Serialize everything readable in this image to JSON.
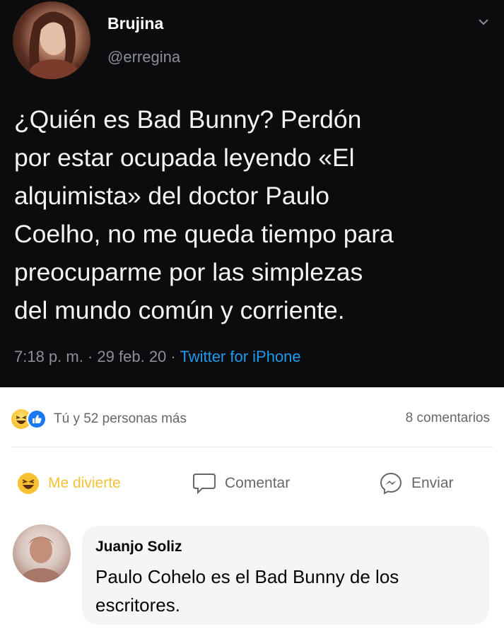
{
  "tweet": {
    "display_name": "Brujina",
    "handle": "@erregina",
    "text_lines": [
      "¿Quién es Bad Bunny? Perdón",
      "por estar ocupada leyendo «El",
      "alquimista» del doctor Paulo",
      "Coelho, no me queda tiempo para",
      "preocuparme por las simplezas",
      "del mundo común y corriente."
    ],
    "time": "7:18 p. m.",
    "date": "29 feb. 20",
    "separator": "·",
    "source": "Twitter for iPhone",
    "menu_icon": "chevron-down-icon",
    "source_color": "#1d9bf0",
    "background": "#0c0c0e"
  },
  "post": {
    "reactions_icons": [
      "haha-reaction-icon",
      "like-reaction-icon"
    ],
    "reactions_text": "Tú y 52 personas más",
    "comments_count": "8 comentarios",
    "actions": {
      "haha_label": "Me divierte",
      "comment_label": "Comentar",
      "send_label": "Enviar"
    },
    "haha_color": "#f7c136"
  },
  "comment": {
    "author": "Juanjo Soliz",
    "text_lines": [
      "Paulo Cohelo es el Bad Bunny de los",
      "escritores."
    ]
  }
}
